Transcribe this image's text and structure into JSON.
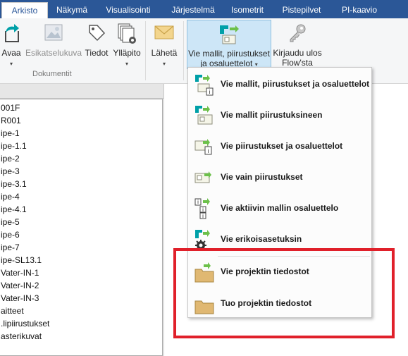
{
  "tabs": [
    {
      "label": "Arkisto",
      "active": true
    },
    {
      "label": "Näkymä"
    },
    {
      "label": "Visualisointi"
    },
    {
      "label": "Järjestelmä"
    },
    {
      "label": "Isometrit"
    },
    {
      "label": "Pistepilvet"
    },
    {
      "label": "PI-kaavio"
    }
  ],
  "ribbon": {
    "open": {
      "label": "Avaa"
    },
    "preview": {
      "label": "Esikatselukuva"
    },
    "info": {
      "label": "Tiedot"
    },
    "maintain": {
      "label": "Ylläpito"
    },
    "send": {
      "label": "Lähetä"
    },
    "export": {
      "label_line1": "Vie mallit, piirustukset",
      "label_line2": "ja osaluettelot"
    },
    "login": {
      "label_line1": "Kirjaudu ulos",
      "label_line2": "Flow'sta"
    },
    "group_documents": "Dokumentit",
    "caret": "▾"
  },
  "tree_items": [
    "001F",
    "R001",
    "ipe-1",
    "ipe-1.1",
    "ipe-2",
    "ipe-3",
    "ipe-3.1",
    "ipe-4",
    "ipe-4.1",
    "ipe-5",
    "ipe-6",
    "ipe-7",
    "ipe-SL13.1",
    "Vater-IN-1",
    "Vater-IN-2",
    "Vater-IN-3",
    "aitteet",
    ".lipiirustukset",
    "asterikuvat"
  ],
  "menu_items": [
    {
      "label": "Vie mallit, piirustukset ja osaluettelot",
      "icon": "export-all-icon"
    },
    {
      "label": "Vie mallit piirustuksineen",
      "icon": "export-models-drawings-icon"
    },
    {
      "label": "Vie piirustukset ja osaluettelot",
      "icon": "export-drawings-lists-icon"
    },
    {
      "label": "Vie vain piirustukset",
      "icon": "export-drawings-icon"
    },
    {
      "label": "Vie aktiivin mallin osaluettelo",
      "icon": "export-parts-list-icon"
    },
    {
      "label": "Vie erikoisasetuksin",
      "icon": "export-special-icon"
    },
    {
      "label": "Vie projektin tiedostot",
      "icon": "folder-export-icon"
    },
    {
      "label": "Tuo projektin tiedostot",
      "icon": "folder-import-icon"
    }
  ],
  "colors": {
    "tab_bar": "#2b5797",
    "highlight_box": "#e0202a",
    "accent_green": "#6cc04a",
    "accent_teal": "#00a0a8",
    "folder": "#e0b872"
  }
}
